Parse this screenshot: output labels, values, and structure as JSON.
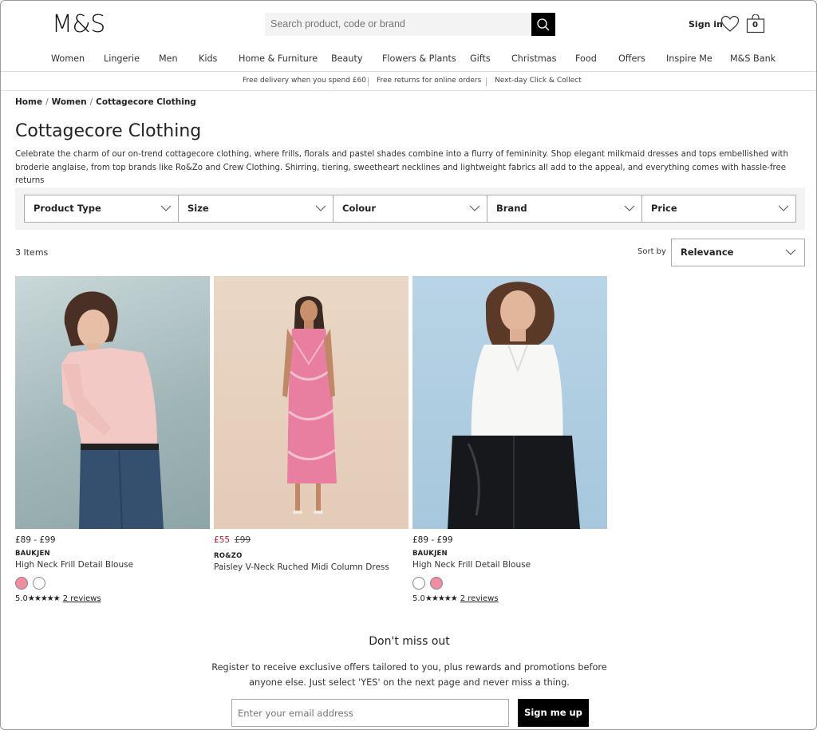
{
  "header": {
    "logo": "M&S",
    "search_placeholder": "Search product, code or brand",
    "sign_in": "Sign in",
    "bag_count": "0"
  },
  "nav": [
    "Women",
    "Lingerie",
    "Men",
    "Kids",
    "Home & Furniture",
    "Beauty",
    "Flowers & Plants",
    "Gifts",
    "Christmas",
    "Food",
    "Offers",
    "Inspire Me",
    "M&S Bank"
  ],
  "usp": [
    "Free delivery when you spend £60",
    "Free returns for online orders",
    "Next-day Click & Collect"
  ],
  "breadcrumb": [
    "Home",
    "Women",
    "Cottagecore Clothing"
  ],
  "page": {
    "title": "Cottagecore Clothing",
    "description": "Celebrate the charm of our on-trend cottagecore clothing, where frills, florals and pastel shades combine into a flurry of femininity. Shop elegant milkmaid dresses and tops embellished with broderie anglaise, from top brands like Ro&Zo and Crew Clothing. Shirring, tiering, sweetheart necklines and lightweight fabrics all add to the appeal, and everything comes with hassle-free returns"
  },
  "filters": [
    "Product Type",
    "Size",
    "Colour",
    "Brand",
    "Price"
  ],
  "results": {
    "count": "3 Items",
    "sort_label": "Sort by",
    "sort_value": "Relevance"
  },
  "products": [
    {
      "price": "£89 - £99",
      "brand": "BAUKJEN",
      "name": "High Neck Frill Detail Blouse",
      "swatches": [
        "#f08da0",
        "#ffffff"
      ],
      "rating": "5.0",
      "stars": "★★★★★",
      "reviews": "2 reviews",
      "image_bg": "#a9bcbd"
    },
    {
      "sale_price": "£55",
      "was_price": "£99",
      "brand": "RO&ZO",
      "name": "Paisley V-Neck Ruched Midi Column Dress",
      "image_bg": "#e6d1c0"
    },
    {
      "price": "£89 - £99",
      "brand": "BAUKJEN",
      "name": "High Neck Frill Detail Blouse",
      "swatches": [
        "#ffffff",
        "#f08da0"
      ],
      "rating": "5.0",
      "stars": "★★★★★",
      "reviews": "2 reviews",
      "image_bg": "#a9cbe0"
    }
  ],
  "newsletter": {
    "title": "Don't miss out",
    "text": "Register to receive exclusive offers tailored to you, plus rewards and promotions before anyone else. Just select 'YES' on the next page and never miss a thing.",
    "email_placeholder": "Enter your email address",
    "button": "Sign me up"
  },
  "colors": {
    "sale_red": "#c8102e",
    "black": "#000000",
    "filter_bg": "#f3f3f3"
  }
}
